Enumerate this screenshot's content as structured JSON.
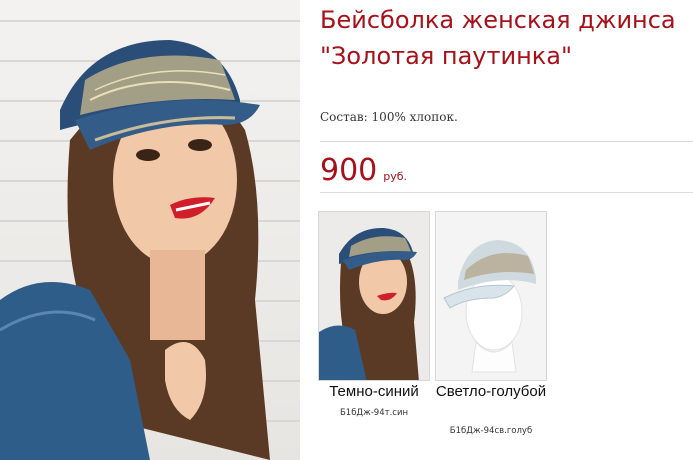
{
  "product": {
    "title": "Бейсболка женская джинса \"Золотая паутинка\"",
    "composition_label": "Состав:",
    "composition_value": "100% хлопок.",
    "price_value": "900",
    "price_currency": "руб."
  },
  "variants": [
    {
      "name": "Темно-синий",
      "sku": "Б1бДж-94т.син"
    },
    {
      "name": "Светло-голубой",
      "sku": "Б1бДж-94св.голуб"
    }
  ],
  "colors": {
    "accent": "#a8101a",
    "denim": "#2a4e78"
  }
}
